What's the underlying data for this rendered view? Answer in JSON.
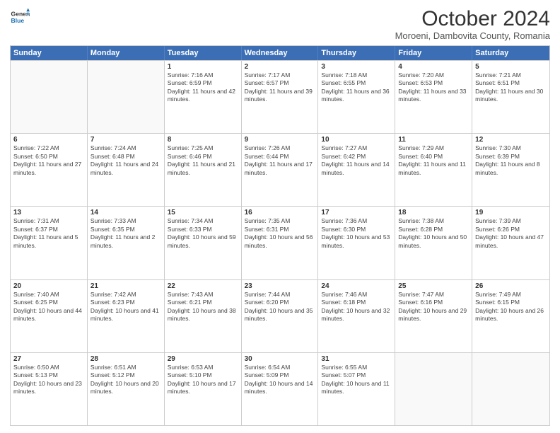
{
  "header": {
    "logo_line1": "General",
    "logo_line2": "Blue",
    "month": "October 2024",
    "location": "Moroeni, Dambovita County, Romania"
  },
  "weekdays": [
    "Sunday",
    "Monday",
    "Tuesday",
    "Wednesday",
    "Thursday",
    "Friday",
    "Saturday"
  ],
  "rows": [
    [
      {
        "day": "",
        "info": ""
      },
      {
        "day": "",
        "info": ""
      },
      {
        "day": "1",
        "info": "Sunrise: 7:16 AM\nSunset: 6:59 PM\nDaylight: 11 hours and 42 minutes."
      },
      {
        "day": "2",
        "info": "Sunrise: 7:17 AM\nSunset: 6:57 PM\nDaylight: 11 hours and 39 minutes."
      },
      {
        "day": "3",
        "info": "Sunrise: 7:18 AM\nSunset: 6:55 PM\nDaylight: 11 hours and 36 minutes."
      },
      {
        "day": "4",
        "info": "Sunrise: 7:20 AM\nSunset: 6:53 PM\nDaylight: 11 hours and 33 minutes."
      },
      {
        "day": "5",
        "info": "Sunrise: 7:21 AM\nSunset: 6:51 PM\nDaylight: 11 hours and 30 minutes."
      }
    ],
    [
      {
        "day": "6",
        "info": "Sunrise: 7:22 AM\nSunset: 6:50 PM\nDaylight: 11 hours and 27 minutes."
      },
      {
        "day": "7",
        "info": "Sunrise: 7:24 AM\nSunset: 6:48 PM\nDaylight: 11 hours and 24 minutes."
      },
      {
        "day": "8",
        "info": "Sunrise: 7:25 AM\nSunset: 6:46 PM\nDaylight: 11 hours and 21 minutes."
      },
      {
        "day": "9",
        "info": "Sunrise: 7:26 AM\nSunset: 6:44 PM\nDaylight: 11 hours and 17 minutes."
      },
      {
        "day": "10",
        "info": "Sunrise: 7:27 AM\nSunset: 6:42 PM\nDaylight: 11 hours and 14 minutes."
      },
      {
        "day": "11",
        "info": "Sunrise: 7:29 AM\nSunset: 6:40 PM\nDaylight: 11 hours and 11 minutes."
      },
      {
        "day": "12",
        "info": "Sunrise: 7:30 AM\nSunset: 6:39 PM\nDaylight: 11 hours and 8 minutes."
      }
    ],
    [
      {
        "day": "13",
        "info": "Sunrise: 7:31 AM\nSunset: 6:37 PM\nDaylight: 11 hours and 5 minutes."
      },
      {
        "day": "14",
        "info": "Sunrise: 7:33 AM\nSunset: 6:35 PM\nDaylight: 11 hours and 2 minutes."
      },
      {
        "day": "15",
        "info": "Sunrise: 7:34 AM\nSunset: 6:33 PM\nDaylight: 10 hours and 59 minutes."
      },
      {
        "day": "16",
        "info": "Sunrise: 7:35 AM\nSunset: 6:31 PM\nDaylight: 10 hours and 56 minutes."
      },
      {
        "day": "17",
        "info": "Sunrise: 7:36 AM\nSunset: 6:30 PM\nDaylight: 10 hours and 53 minutes."
      },
      {
        "day": "18",
        "info": "Sunrise: 7:38 AM\nSunset: 6:28 PM\nDaylight: 10 hours and 50 minutes."
      },
      {
        "day": "19",
        "info": "Sunrise: 7:39 AM\nSunset: 6:26 PM\nDaylight: 10 hours and 47 minutes."
      }
    ],
    [
      {
        "day": "20",
        "info": "Sunrise: 7:40 AM\nSunset: 6:25 PM\nDaylight: 10 hours and 44 minutes."
      },
      {
        "day": "21",
        "info": "Sunrise: 7:42 AM\nSunset: 6:23 PM\nDaylight: 10 hours and 41 minutes."
      },
      {
        "day": "22",
        "info": "Sunrise: 7:43 AM\nSunset: 6:21 PM\nDaylight: 10 hours and 38 minutes."
      },
      {
        "day": "23",
        "info": "Sunrise: 7:44 AM\nSunset: 6:20 PM\nDaylight: 10 hours and 35 minutes."
      },
      {
        "day": "24",
        "info": "Sunrise: 7:46 AM\nSunset: 6:18 PM\nDaylight: 10 hours and 32 minutes."
      },
      {
        "day": "25",
        "info": "Sunrise: 7:47 AM\nSunset: 6:16 PM\nDaylight: 10 hours and 29 minutes."
      },
      {
        "day": "26",
        "info": "Sunrise: 7:49 AM\nSunset: 6:15 PM\nDaylight: 10 hours and 26 minutes."
      }
    ],
    [
      {
        "day": "27",
        "info": "Sunrise: 6:50 AM\nSunset: 5:13 PM\nDaylight: 10 hours and 23 minutes."
      },
      {
        "day": "28",
        "info": "Sunrise: 6:51 AM\nSunset: 5:12 PM\nDaylight: 10 hours and 20 minutes."
      },
      {
        "day": "29",
        "info": "Sunrise: 6:53 AM\nSunset: 5:10 PM\nDaylight: 10 hours and 17 minutes."
      },
      {
        "day": "30",
        "info": "Sunrise: 6:54 AM\nSunset: 5:09 PM\nDaylight: 10 hours and 14 minutes."
      },
      {
        "day": "31",
        "info": "Sunrise: 6:55 AM\nSunset: 5:07 PM\nDaylight: 10 hours and 11 minutes."
      },
      {
        "day": "",
        "info": ""
      },
      {
        "day": "",
        "info": ""
      }
    ]
  ]
}
